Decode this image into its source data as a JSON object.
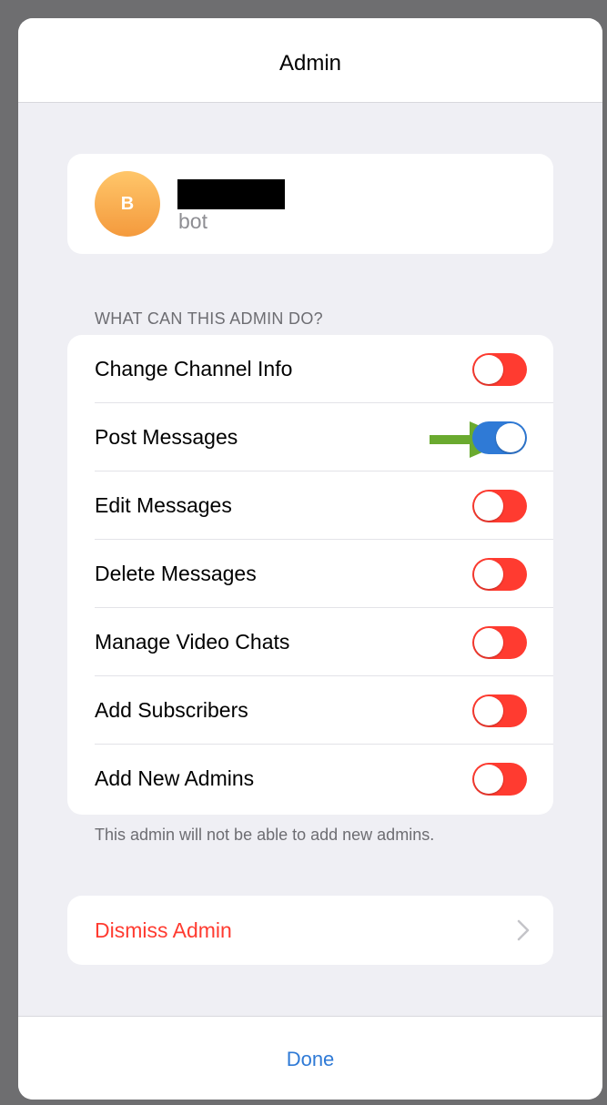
{
  "navbar": {
    "title": "Admin"
  },
  "user": {
    "avatar_letter": "B",
    "subtitle": "bot",
    "avatar_gradient": [
      "#ffc66a",
      "#f49a3d"
    ]
  },
  "permissions": {
    "header": "WHAT CAN THIS ADMIN DO?",
    "items": [
      {
        "label": "Change Channel Info",
        "enabled": false
      },
      {
        "label": "Post Messages",
        "enabled": true
      },
      {
        "label": "Edit Messages",
        "enabled": false
      },
      {
        "label": "Delete Messages",
        "enabled": false
      },
      {
        "label": "Manage Video Chats",
        "enabled": false
      },
      {
        "label": "Add Subscribers",
        "enabled": false
      },
      {
        "label": "Add New Admins",
        "enabled": false
      }
    ],
    "footer": "This admin will not be able to add new admins."
  },
  "dismiss": {
    "label": "Dismiss Admin",
    "icon": "chevron-right-icon"
  },
  "bottom": {
    "done_label": "Done"
  },
  "annotation": {
    "icon": "green-arrow-icon",
    "color": "#6aaa2f"
  },
  "colors": {
    "toggle_off": "#ff3b30",
    "toggle_on": "#2f7ad6",
    "destructive": "#ff3b30",
    "accent": "#2f7ad6",
    "background": "#efeff4"
  }
}
